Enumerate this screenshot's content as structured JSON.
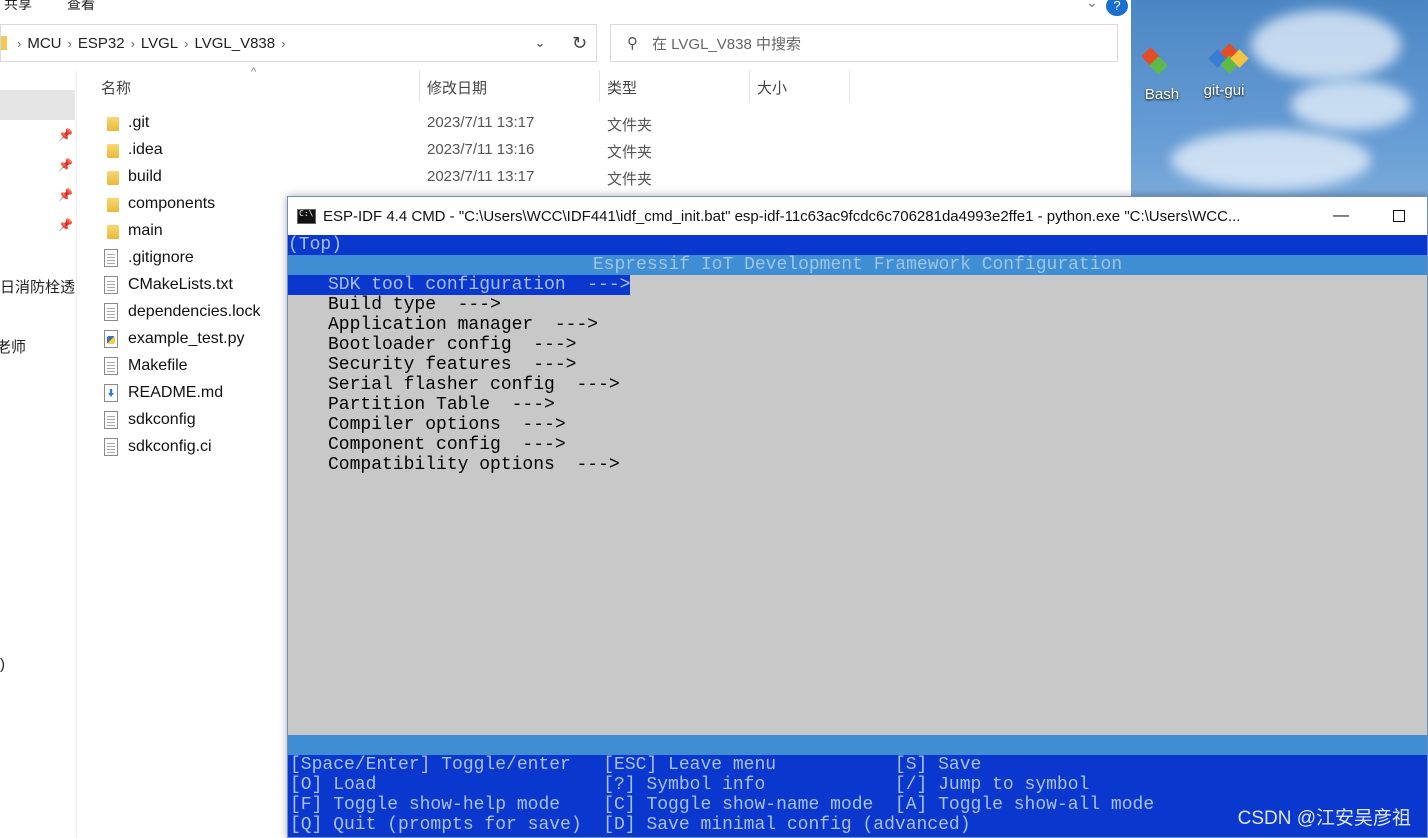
{
  "explorer": {
    "ribbon": {
      "share": "共享",
      "view": "查看"
    },
    "breadcrumb": [
      "MCU",
      "ESP32",
      "LVGL",
      "LVGL_V838"
    ],
    "search_placeholder": "在 LVGL_V838 中搜索",
    "nav_items": [
      "日消防栓透",
      "老师"
    ],
    "nav_misc": ")",
    "columns": {
      "name": "名称",
      "date": "修改日期",
      "type": "类型",
      "size": "大小"
    },
    "files": [
      {
        "name": ".git",
        "date": "2023/7/11 13:17",
        "type": "文件夹",
        "icon": "folder-icon"
      },
      {
        "name": ".idea",
        "date": "2023/7/11 13:16",
        "type": "文件夹",
        "icon": "folder-icon"
      },
      {
        "name": "build",
        "date": "2023/7/11 13:17",
        "type": "文件夹",
        "icon": "folder-icon"
      },
      {
        "name": "components",
        "icon": "folder-icon"
      },
      {
        "name": "main",
        "icon": "folder-icon"
      },
      {
        "name": ".gitignore",
        "icon": "file-icon"
      },
      {
        "name": "CMakeLists.txt",
        "icon": "file-icon"
      },
      {
        "name": "dependencies.lock",
        "icon": "file-icon"
      },
      {
        "name": "example_test.py",
        "icon": "python-file-icon"
      },
      {
        "name": "Makefile",
        "icon": "file-icon"
      },
      {
        "name": "README.md",
        "icon": "markdown-file-icon"
      },
      {
        "name": "sdkconfig",
        "icon": "file-icon"
      },
      {
        "name": "sdkconfig.ci",
        "icon": "file-icon"
      }
    ]
  },
  "desktop": {
    "icons": [
      {
        "label": "Bash",
        "icon": "git-bash-icon"
      },
      {
        "label": "git-gui",
        "icon": "git-gui-icon"
      }
    ]
  },
  "cmd": {
    "title": "ESP-IDF 4.4 CMD - \"C:\\Users\\WCC\\IDF441\\idf_cmd_init.bat\"  esp-idf-11c63ac9fcdc6c706281da4993e2ffe1 - python.exe  \"C:\\Users\\WCC...",
    "breadcrumb": "(Top)",
    "header": "Espressif IoT Development Framework Configuration",
    "menu_items": [
      "SDK tool configuration  --->",
      "Build type  --->",
      "Application manager  --->",
      "Bootloader config  --->",
      "Security features  --->",
      "Serial flasher config  --->",
      "Partition Table  --->",
      "Compiler options  --->",
      "Component config  --->",
      "Compatibility options  --->"
    ],
    "selected_index": 0,
    "footer": [
      "[Space/Enter] Toggle/enter   [ESC] Leave menu           [S] Save",
      "[O] Load                     [?] Symbol info            [/] Jump to symbol",
      "[F] Toggle show-help mode    [C] Toggle show-name mode  [A] Toggle show-all mode",
      "[Q] Quit (prompts for save)  [D] Save minimal config (advanced)"
    ],
    "watermark": "CSDN @江安吴彦祖"
  },
  "colors": {
    "term_bg": "#c8c8c8",
    "term_blue": "#0a38ce",
    "term_cyan": "#3f8ed3",
    "term_highlight_text": "#a9c0f4"
  }
}
